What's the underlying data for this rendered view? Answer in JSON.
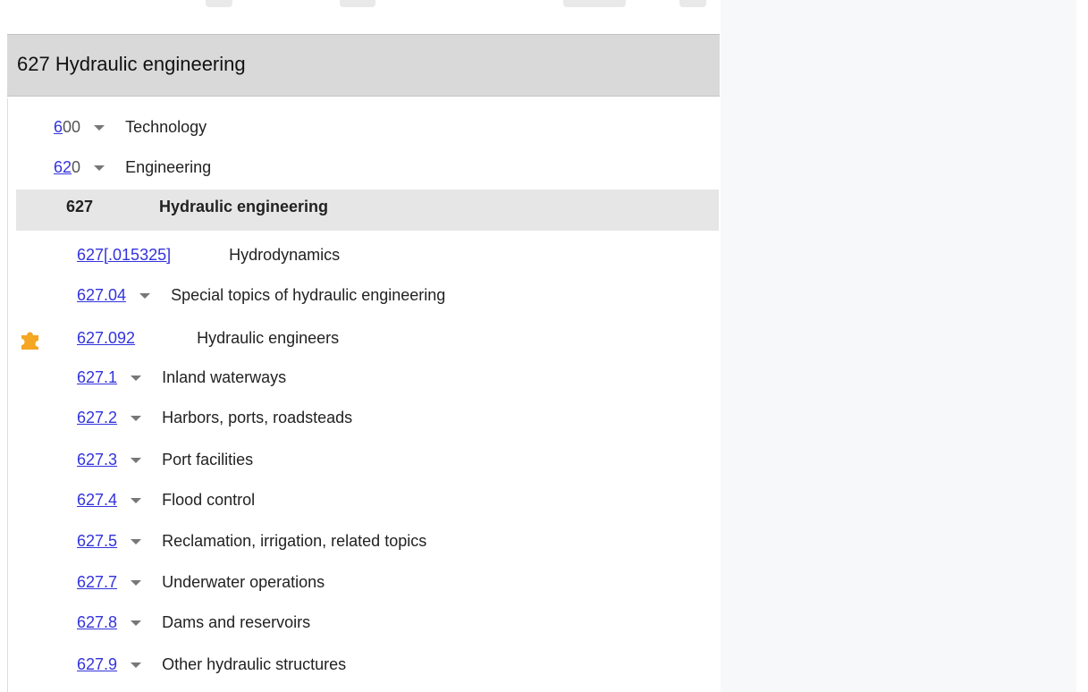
{
  "header": {
    "title": "627 Hydraulic engineering"
  },
  "hierarchy": [
    {
      "link_part": "6",
      "gray_part": "00",
      "label": "Technology"
    },
    {
      "link_part": "62",
      "gray_part": "0",
      "label": "Engineering"
    }
  ],
  "current": {
    "number": "627",
    "label": "Hydraulic engineering"
  },
  "entries": [
    {
      "number": "627[.015325]",
      "label": "Hydrodynamics",
      "has_caret": false
    },
    {
      "number": "627.04",
      "label": "Special topics of hydraulic engineering",
      "has_caret": true
    },
    {
      "number": "627.092",
      "label": "Hydraulic engineers",
      "has_caret": false,
      "icon": "puzzle-icon"
    },
    {
      "number": "627.1",
      "label": "Inland waterways",
      "has_caret": true
    },
    {
      "number": "627.2",
      "label": "Harbors, ports, roadsteads",
      "has_caret": true
    },
    {
      "number": "627.3",
      "label": "Port facilities",
      "has_caret": true
    },
    {
      "number": "627.4",
      "label": "Flood control",
      "has_caret": true
    },
    {
      "number": "627.5",
      "label": "Reclamation, irrigation, related topics",
      "has_caret": true
    },
    {
      "number": "627.7",
      "label": "Underwater operations",
      "has_caret": true
    },
    {
      "number": "627.8",
      "label": "Dams and reservoirs",
      "has_caret": true
    },
    {
      "number": "627.9",
      "label": "Other hydraulic structures",
      "has_caret": true
    }
  ],
  "colors": {
    "link": "#3333dd",
    "header_bg": "#d9d9d9",
    "current_bg": "#e6e6e6",
    "puzzle_icon": "#f5a623"
  }
}
